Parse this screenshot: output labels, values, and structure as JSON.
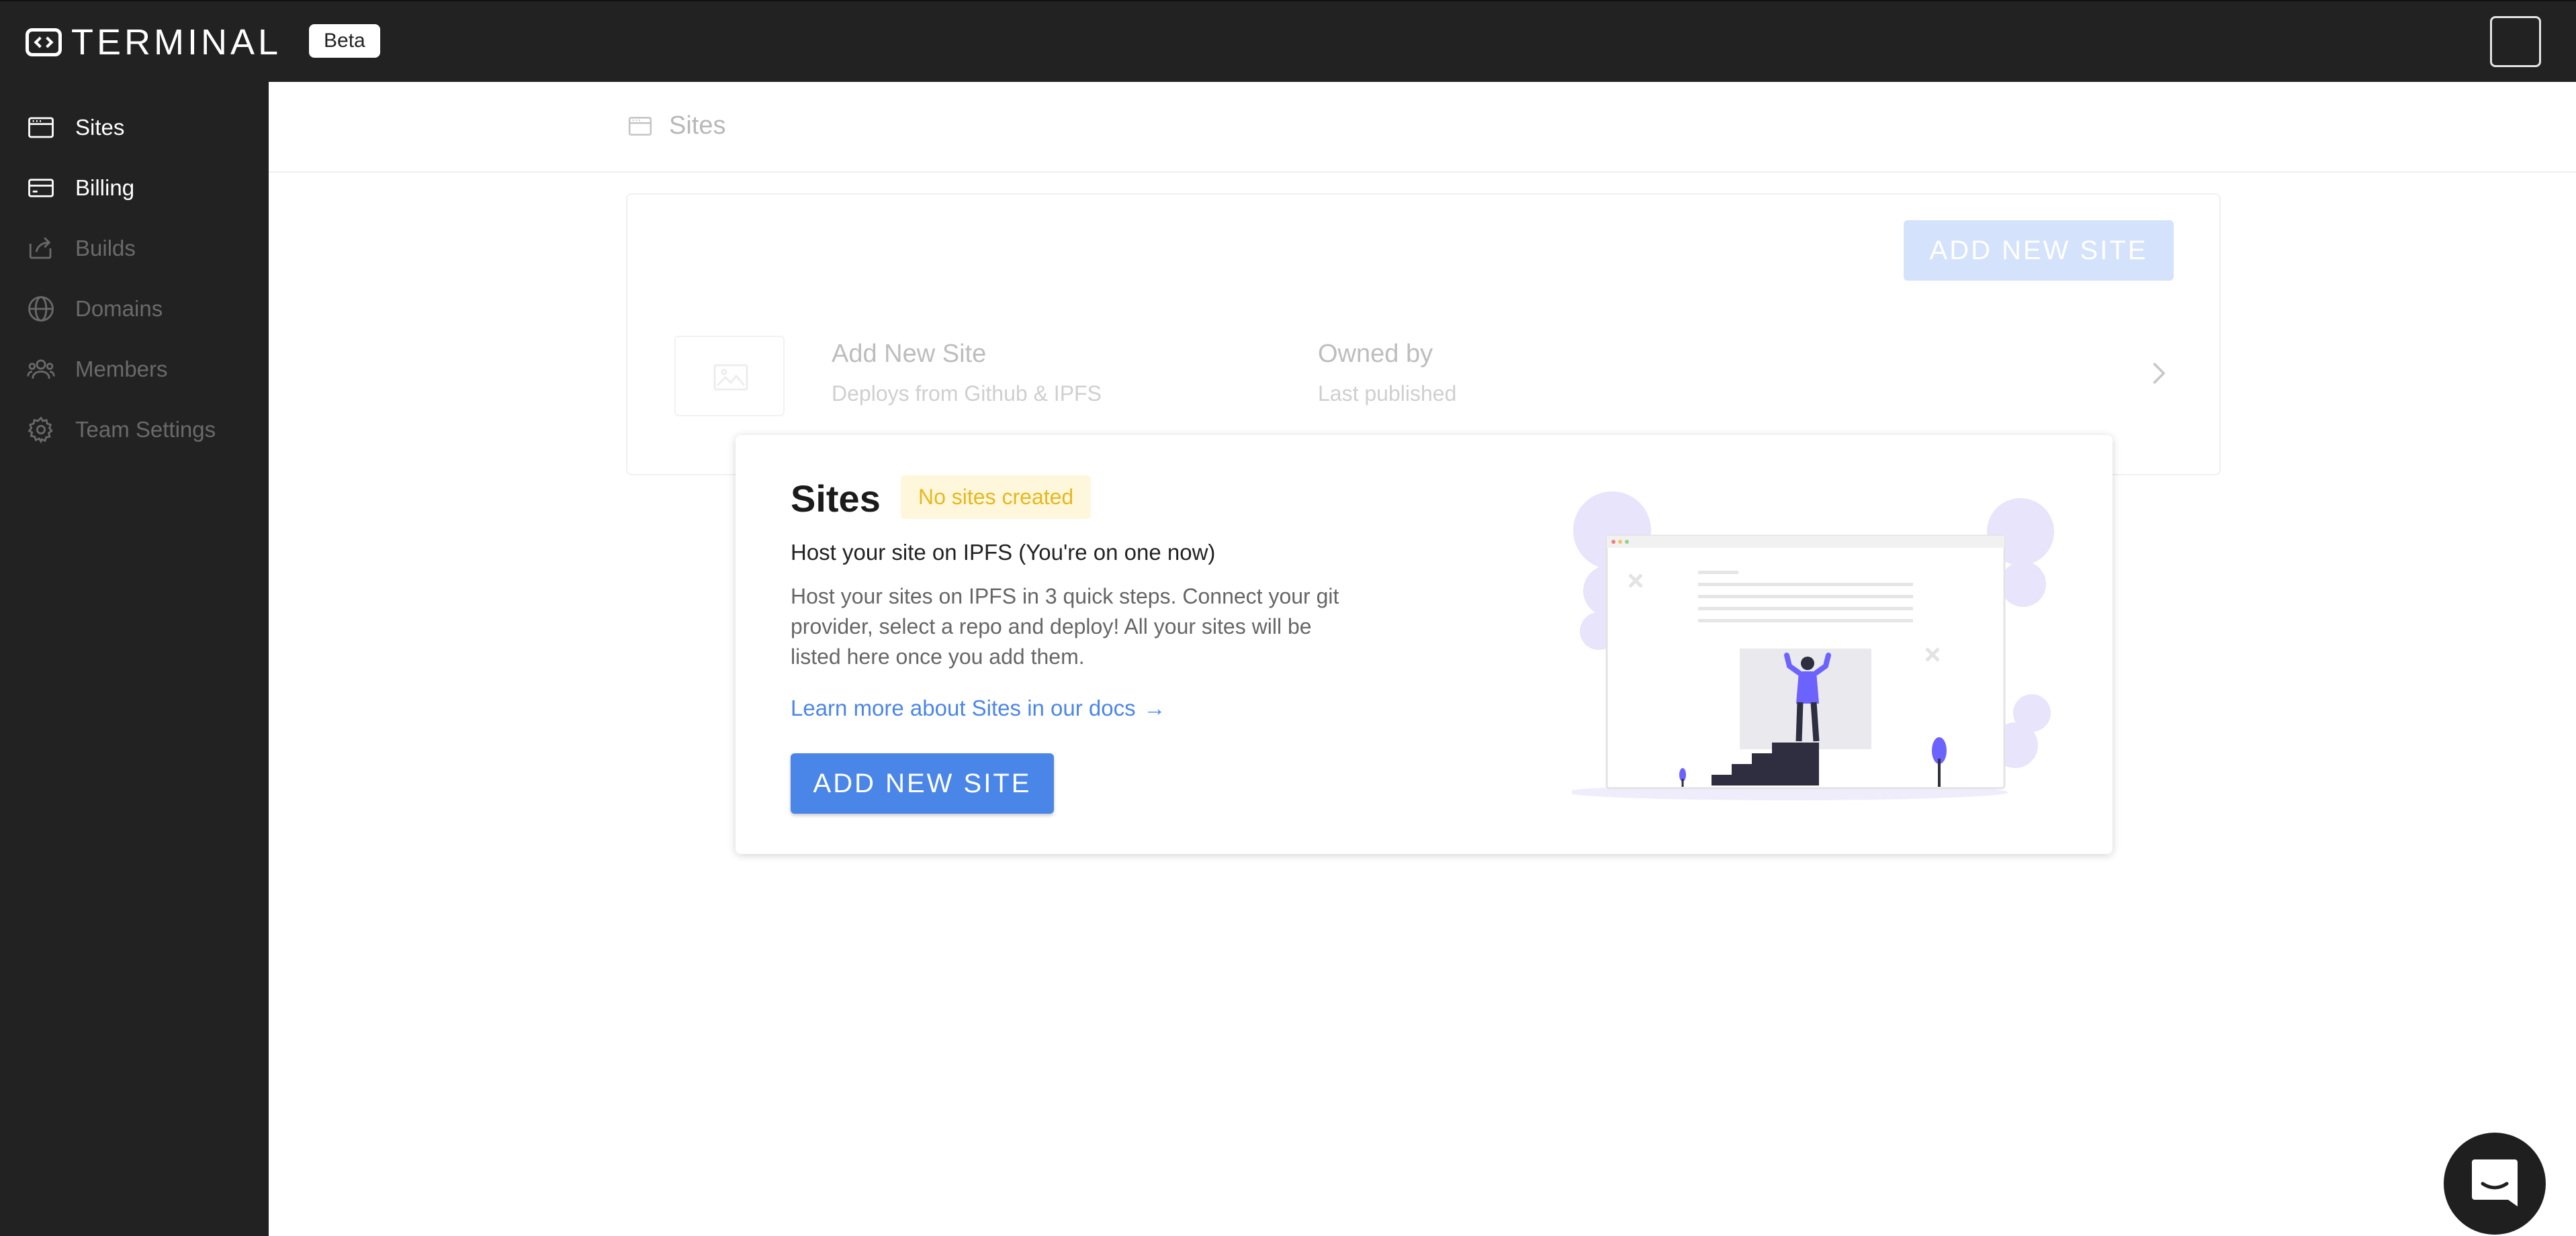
{
  "header": {
    "logo_text": "TERMINAL",
    "beta_label": "Beta"
  },
  "sidebar": {
    "items": [
      {
        "label": "Sites",
        "icon": "browser-icon",
        "active": true
      },
      {
        "label": "Billing",
        "icon": "credit-card-icon",
        "active": true
      },
      {
        "label": "Builds",
        "icon": "share-icon",
        "active": false
      },
      {
        "label": "Domains",
        "icon": "globe-icon",
        "active": false
      },
      {
        "label": "Members",
        "icon": "users-icon",
        "active": false
      },
      {
        "label": "Team Settings",
        "icon": "gear-icon",
        "active": false
      }
    ]
  },
  "breadcrumb": {
    "label": "Sites"
  },
  "sites_list": {
    "add_button": "ADD NEW SITE",
    "row": {
      "title": "Add New Site",
      "subtitle": "Deploys from Github & IPFS",
      "owner_label": "Owned by",
      "owner_sub": "Last published"
    }
  },
  "popup": {
    "title": "Sites",
    "badge": "No sites created",
    "heading": "Host your site on IPFS (You're on one now)",
    "description": "Host your sites on IPFS in 3 quick steps. Connect your git provider, select a repo and deploy! All your sites will be listed here once you add them.",
    "link_text": "Learn more about Sites in our docs",
    "link_arrow": "→",
    "button": "ADD NEW SITE"
  },
  "colors": {
    "sidebar_bg": "#222222",
    "accent": "#4a86e8",
    "accent_faded": "#d5e2fb",
    "badge_bg": "#fff7dc",
    "badge_text": "#e7b81c",
    "illustration_purple": "#6c63ff"
  }
}
